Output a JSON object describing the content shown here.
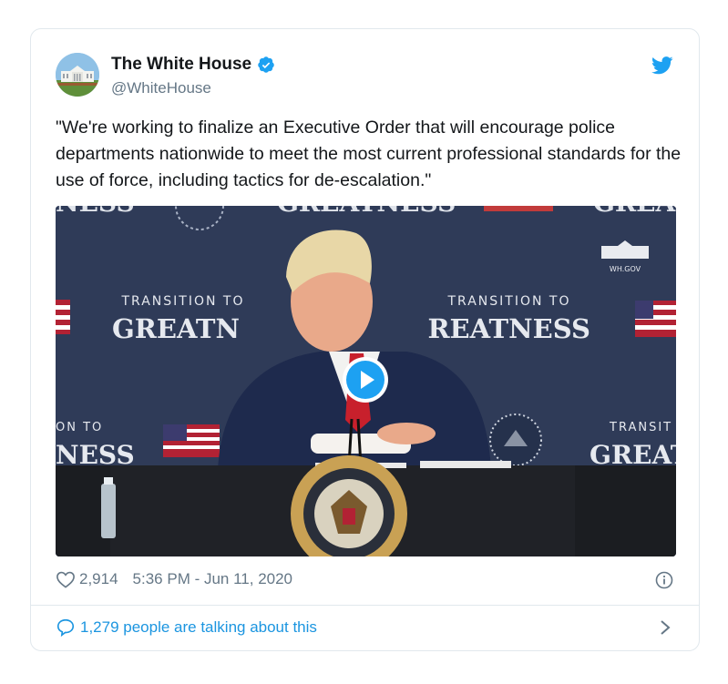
{
  "tweet": {
    "author_name": "The White House",
    "author_handle": "@WhiteHouse",
    "text": "\"We're working to finalize an Executive Order that will encourage police departments nationwide to meet the most current professional standards for the use of force, including tactics for de-escalation.\"",
    "likes": "2,914",
    "timestamp": "5:36 PM - Jun 11, 2020",
    "talking": "1,279 people are talking about this"
  },
  "video": {
    "backdrop_line1": "TRANSITION TO",
    "backdrop_line2": "GREATNESS",
    "backdrop_left_partial": "GREATN",
    "backdrop_right_partial": "REATNESS",
    "backdrop_lower_left_top": "ON TO",
    "backdrop_lower_left_bottom": "NESS",
    "backdrop_lower_right_top": "TRANSIT",
    "backdrop_lower_right_bottom": "GREAT",
    "top_edge_left": "NESS",
    "top_edge_center": "GREATNESS",
    "top_edge_right": "GREA",
    "wh_logo_text": "WH.GOV"
  },
  "icons": {
    "verified": "verified-badge-icon",
    "bird": "twitter-bird-icon",
    "like": "heart-icon",
    "info": "info-icon",
    "reply": "speech-bubble-icon",
    "chevron": "chevron-right-icon",
    "play": "play-icon"
  },
  "colors": {
    "twitter_blue": "#1da1f2",
    "link_blue": "#1b95e0",
    "secondary_text": "#657786",
    "backdrop_navy": "#2e3a57"
  }
}
